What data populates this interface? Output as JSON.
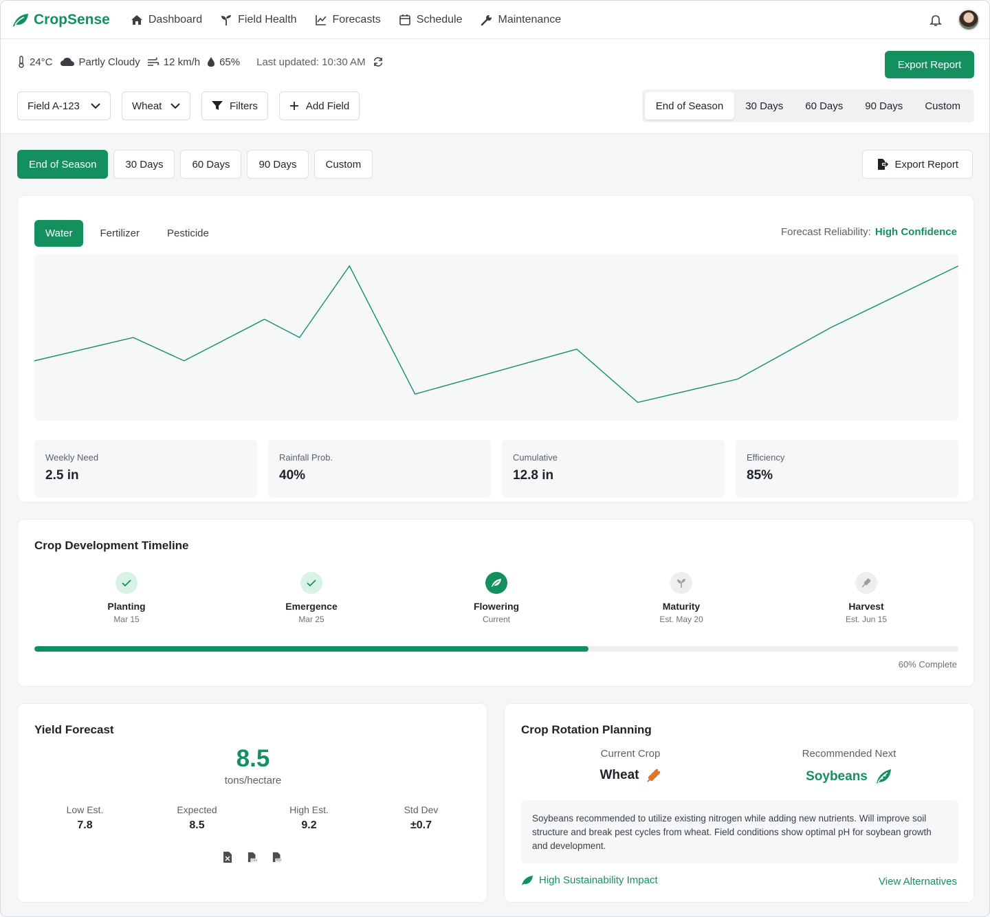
{
  "brand": {
    "name": "CropSense",
    "color": "#14905f"
  },
  "nav": {
    "items": [
      {
        "label": "Dashboard",
        "icon": "home-icon"
      },
      {
        "label": "Field Health",
        "icon": "sprout-icon"
      },
      {
        "label": "Forecasts",
        "icon": "chart-line-icon"
      },
      {
        "label": "Schedule",
        "icon": "calendar-icon"
      },
      {
        "label": "Maintenance",
        "icon": "wrench-icon"
      }
    ]
  },
  "weather": {
    "temperature": "24°C",
    "condition": "Partly Cloudy",
    "wind": "12 km/h",
    "humidity": "65%",
    "last_updated": "Last updated: 10:30 AM"
  },
  "actions": {
    "export_label": "Export Report",
    "filters_label": "Filters",
    "add_field_label": "Add Field"
  },
  "selects": {
    "field": "Field A-123",
    "crop": "Wheat"
  },
  "range_tabs": [
    "End of Season",
    "30 Days",
    "60 Days",
    "90 Days",
    "Custom"
  ],
  "range_active": "End of Season",
  "resource_tabs": [
    "Water",
    "Fertilizer",
    "Pesticide"
  ],
  "resource_active": "Water",
  "reliability": {
    "label": "Forecast Reliability:",
    "value": "High Confidence"
  },
  "chart_data": {
    "type": "line",
    "series": [
      {
        "values": [
          0.36,
          0.5,
          0.36,
          0.61,
          0.5,
          0.93,
          0.16,
          0.43,
          0.11,
          0.25,
          0.56,
          0.93
        ]
      }
    ],
    "x": [
      0,
      0.107,
      0.162,
      0.249,
      0.287,
      0.341,
      0.412,
      0.587,
      0.653,
      0.761,
      0.862,
      1.0
    ],
    "title": "",
    "xlabel": "",
    "ylabel": "",
    "grid": false,
    "color": "#14905f"
  },
  "stats": [
    {
      "label": "Weekly Need",
      "value": "2.5 in"
    },
    {
      "label": "Rainfall Prob.",
      "value": "40%"
    },
    {
      "label": "Cumulative",
      "value": "12.8 in"
    },
    {
      "label": "Efficiency",
      "value": "85%"
    }
  ],
  "timeline": {
    "title": "Crop Development Timeline",
    "stages": [
      {
        "name": "Planting",
        "date": "Mar 15",
        "status": "done",
        "icon": "check-icon"
      },
      {
        "name": "Emergence",
        "date": "Mar 25",
        "status": "done",
        "icon": "check-icon"
      },
      {
        "name": "Flowering",
        "date": "Current",
        "status": "current",
        "icon": "leaf-icon"
      },
      {
        "name": "Maturity",
        "date": "Est. May 20",
        "status": "upcoming",
        "icon": "seedling-icon"
      },
      {
        "name": "Harvest",
        "date": "Est. Jun 15",
        "status": "upcoming",
        "icon": "wheat-icon"
      }
    ],
    "progress": 0.6,
    "progress_label": "60% Complete"
  },
  "yield": {
    "title": "Yield Forecast",
    "value": "8.5",
    "unit": "tons/hectare",
    "stats": [
      {
        "label": "Low Est.",
        "value": "7.8"
      },
      {
        "label": "Expected",
        "value": "8.5"
      },
      {
        "label": "High Est.",
        "value": "9.2"
      },
      {
        "label": "Std Dev",
        "value": "±0.7"
      }
    ],
    "exports": [
      "excel-file-icon",
      "csv-file-icon",
      "pdf-file-icon"
    ]
  },
  "rotation": {
    "title": "Crop Rotation Planning",
    "current_label": "Current Crop",
    "current_value": "Wheat",
    "next_label": "Recommended Next",
    "next_value": "Soybeans",
    "note": "Soybeans recommended to utilize existing nitrogen while adding new nutrients. Will improve soil structure and break pest cycles from wheat. Field conditions show optimal pH for soybean growth and development.",
    "impact": "High Sustainability Impact",
    "alternatives": "View Alternatives"
  }
}
